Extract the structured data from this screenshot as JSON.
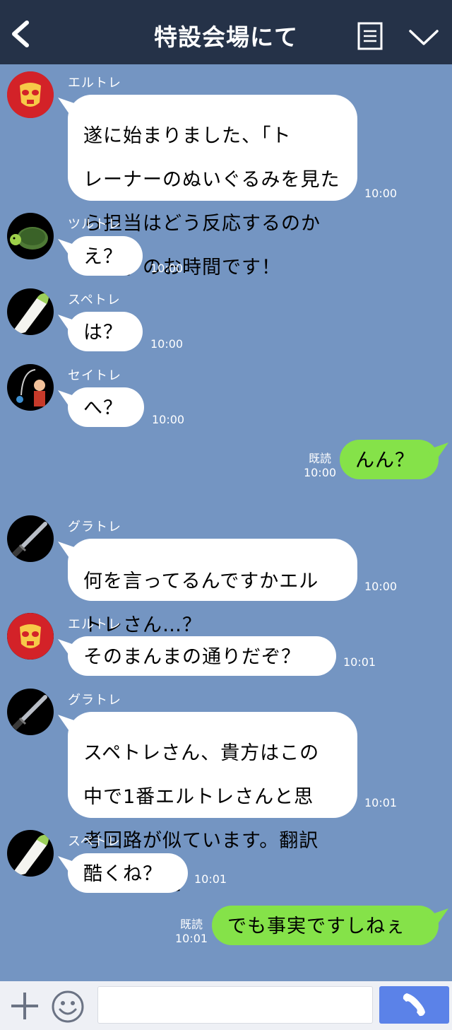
{
  "header": {
    "title": "特設会場にて"
  },
  "messages": [
    {
      "type": "in",
      "sender": "エルトレ",
      "avatar": "mask",
      "text": "遂に始まりました、「トレーナーのぬいぐるみを見たら担当はどう反応するのか検証」のお時間です！",
      "lines": [
        "遂に始まりました、「ト",
        "レーナーのぬいぐるみを見た",
        "ら担当はどう反応するのか",
        "検証」のお時間です！"
      ],
      "time": "10:00"
    },
    {
      "type": "in",
      "sender": "ツルトレ",
      "avatar": "turtle",
      "text": "え？",
      "time": "10:00"
    },
    {
      "type": "in",
      "sender": "スペトレ",
      "avatar": "radish",
      "text": "は？",
      "time": "10:00"
    },
    {
      "type": "in",
      "sender": "セイトレ",
      "avatar": "fishing",
      "text": "へ？",
      "time": "10:00"
    },
    {
      "type": "out",
      "text": "んん？",
      "read": "既読",
      "time": "10:00"
    },
    {
      "type": "in",
      "sender": "グラトレ",
      "avatar": "sword",
      "text": "何を言ってるんですかエルトレさん…？",
      "lines": [
        "何を言ってるんですかエル",
        "トレさん…？"
      ],
      "time": "10:00"
    },
    {
      "type": "in",
      "sender": "エルトレ",
      "avatar": "mask",
      "text": "そのまんまの通りだぞ？",
      "time": "10:01"
    },
    {
      "type": "in",
      "sender": "グラトレ",
      "avatar": "sword",
      "text": "スペトレさん、貴方はこの中で1番エルトレさんと思考回路が似ています。翻訳任せました",
      "lines": [
        "スペトレさん、貴方はこの",
        "中で1番エルトレさんと思",
        "考回路が似ています。翻訳",
        "任せました"
      ],
      "time": "10:01"
    },
    {
      "type": "in",
      "sender": "スペトレ",
      "avatar": "radish",
      "text": "酷くね？",
      "time": "10:01"
    },
    {
      "type": "out",
      "text": "でも事実ですしねぇ",
      "read": "既読",
      "time": "10:01"
    }
  ],
  "icons": {
    "back": "chevron-left-icon",
    "menu": "menu-icon",
    "expand": "chevron-down-icon",
    "add": "plus-icon",
    "emoji": "smile-icon",
    "call": "phone-icon"
  },
  "colors": {
    "background": "#7495c2",
    "header": "#253248",
    "outgoing_bubble": "#85e249",
    "incoming_bubble": "#ffffff",
    "call_button": "#5b82e8"
  }
}
